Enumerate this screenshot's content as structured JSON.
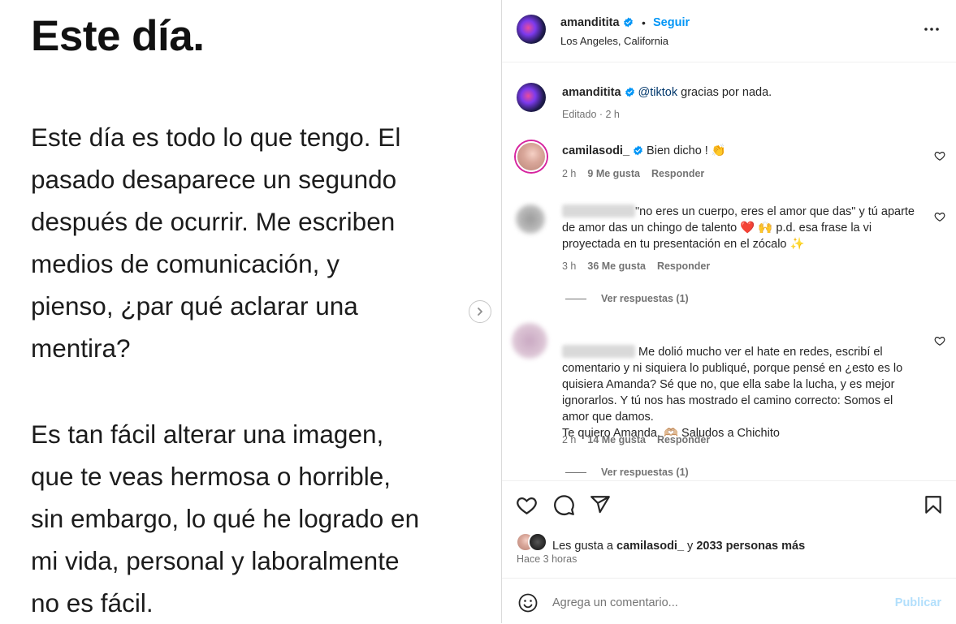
{
  "post": {
    "title": "Este día.",
    "paragraph1": "Este día es todo lo que tengo. El\npasado desaparece un segundo\ndespués de ocurrir.  Me escriben\nmedios de comunicación, y\npienso, ¿par qué aclarar una\nmentira?",
    "paragraph2": "Es tan fácil alterar una imagen,\nque te veas hermosa o horrible,\nsin embargo, lo qué he logrado en\nmi vida, personal y laboralmente\nno es fácil."
  },
  "header": {
    "username": "amanditita",
    "dot": "•",
    "follow_label": "Seguir",
    "location": "Los Angeles, California"
  },
  "caption": {
    "username": "amanditita",
    "mention": "@tiktok",
    "text": " gracias por nada.",
    "meta": "Editado · 2 h"
  },
  "comments": [
    {
      "username": "camilasodi_",
      "text": "Bien dicho ! 👏",
      "time": "2 h",
      "likes": "9 Me gusta",
      "reply_label": "Responder"
    },
    {
      "username": "",
      "text": "\"no eres un cuerpo, eres el amor que das\" y tú aparte de amor das un chingo de talento ❤️ 🙌 p.d. esa frase la vi proyectada en tu presentación en el zócalo ✨",
      "time": "3 h",
      "likes": "36 Me gusta",
      "reply_label": "Responder",
      "view_replies": "Ver respuestas (1)"
    },
    {
      "username": "",
      "text": " Me dolió mucho ver el hate en redes, escribí el comentario y ni siquiera lo publiqué, porque pensé en ¿esto es lo quisiera Amanda? Sé que no, que ella sabe la lucha, y es mejor ignorarlos. Y tú nos has mostrado el camino correcto: Somos el amor que damos.\nTe quiero Amanda. 🫶🏼 Saludos a Chichito",
      "time": "2 h",
      "likes": "14 Me gusta",
      "reply_label": "Responder",
      "view_replies": "Ver respuestas (1)"
    }
  ],
  "likes": {
    "prefix": "Les gusta a ",
    "user": "camilasodi_",
    "middle": " y ",
    "others": "2033 personas más"
  },
  "posted_ago": "Hace 3 horas",
  "add_comment": {
    "placeholder": "Agrega un comentario...",
    "publish_label": "Publicar"
  },
  "icons": {
    "like": "heart-icon",
    "comment": "comment-icon",
    "share": "share-icon",
    "save": "bookmark-icon",
    "more": "more-options-icon",
    "emoji": "emoji-icon",
    "next": "chevron-right-icon",
    "verified": "verified-badge-icon"
  },
  "colors": {
    "link": "#0095f6",
    "mention": "#00376b",
    "muted": "#737373",
    "publish_disabled": "#b2dffc",
    "verified": "#0095f6"
  }
}
